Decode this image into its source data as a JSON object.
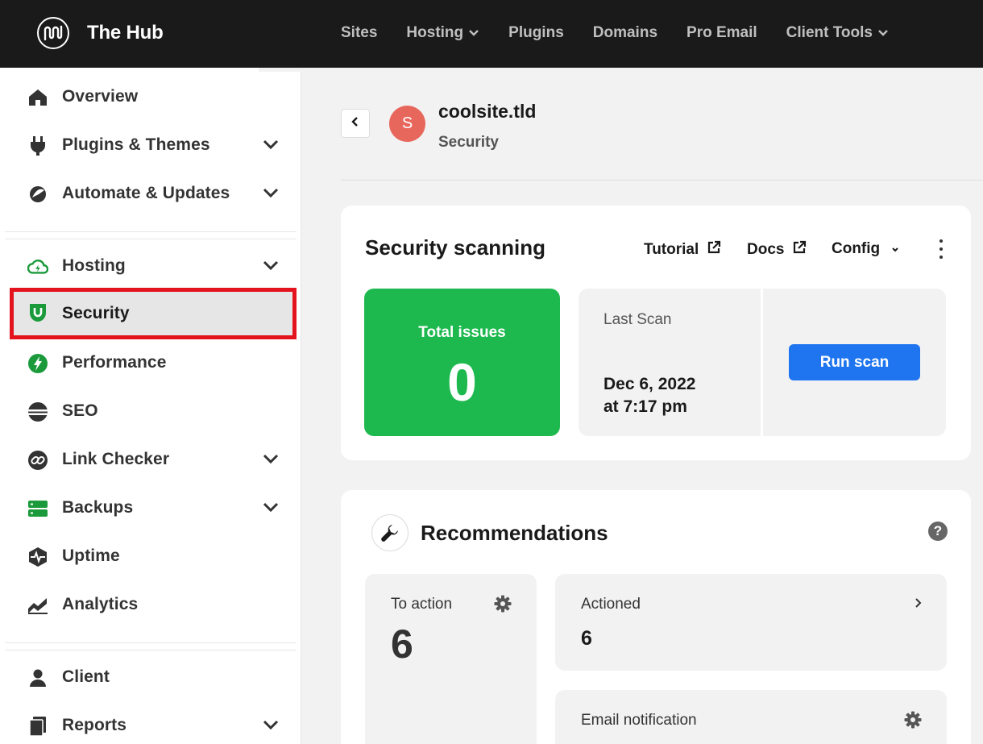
{
  "app": {
    "name": "The Hub",
    "logo_icon": "wpmudev-logo-icon"
  },
  "topnav": [
    {
      "label": "Sites",
      "has_dropdown": false
    },
    {
      "label": "Hosting",
      "has_dropdown": true
    },
    {
      "label": "Plugins",
      "has_dropdown": false
    },
    {
      "label": "Domains",
      "has_dropdown": false
    },
    {
      "label": "Pro Email",
      "has_dropdown": false
    },
    {
      "label": "Client Tools",
      "has_dropdown": true
    }
  ],
  "sidebar": {
    "items": [
      {
        "label": "Overview",
        "icon": "home-icon",
        "expandable": false
      },
      {
        "label": "Plugins & Themes",
        "icon": "plug-icon",
        "expandable": true
      },
      {
        "label": "Automate & Updates",
        "icon": "automate-icon",
        "expandable": true
      },
      {
        "label": "Hosting",
        "icon": "cloud-icon",
        "expandable": true
      },
      {
        "label": "Security",
        "icon": "shield-icon",
        "expandable": false,
        "active": true
      },
      {
        "label": "Performance",
        "icon": "bolt-icon",
        "expandable": false
      },
      {
        "label": "SEO",
        "icon": "seo-icon",
        "expandable": false
      },
      {
        "label": "Link Checker",
        "icon": "link-icon",
        "expandable": true
      },
      {
        "label": "Backups",
        "icon": "backups-icon",
        "expandable": true
      },
      {
        "label": "Uptime",
        "icon": "uptime-icon",
        "expandable": false
      },
      {
        "label": "Analytics",
        "icon": "analytics-icon",
        "expandable": false
      },
      {
        "label": "Client",
        "icon": "user-icon",
        "expandable": false
      },
      {
        "label": "Reports",
        "icon": "reports-icon",
        "expandable": true
      }
    ]
  },
  "site": {
    "avatar_letter": "S",
    "name": "coolsite.tld",
    "section": "Security"
  },
  "scanning": {
    "title": "Security scanning",
    "tutorial_label": "Tutorial",
    "docs_label": "Docs",
    "config_label": "Config",
    "total_issues_label": "Total issues",
    "total_issues": "0",
    "last_scan_label": "Last Scan",
    "last_scan_date": "Dec 6, 2022",
    "last_scan_time": "at 7:17 pm",
    "run_scan_label": "Run scan"
  },
  "recommendations": {
    "title": "Recommendations",
    "help_label": "?",
    "to_action_label": "To action",
    "to_action_count": "6",
    "actioned_label": "Actioned",
    "actioned_count": "6",
    "email_label": "Email notification"
  },
  "colors": {
    "topbar": "#1a1a1a",
    "success": "#1db94e",
    "primary_button": "#1f75f0",
    "active_highlight": "#e3141e",
    "avatar": "#e8675c",
    "icon_green": "#1a9a3a"
  }
}
